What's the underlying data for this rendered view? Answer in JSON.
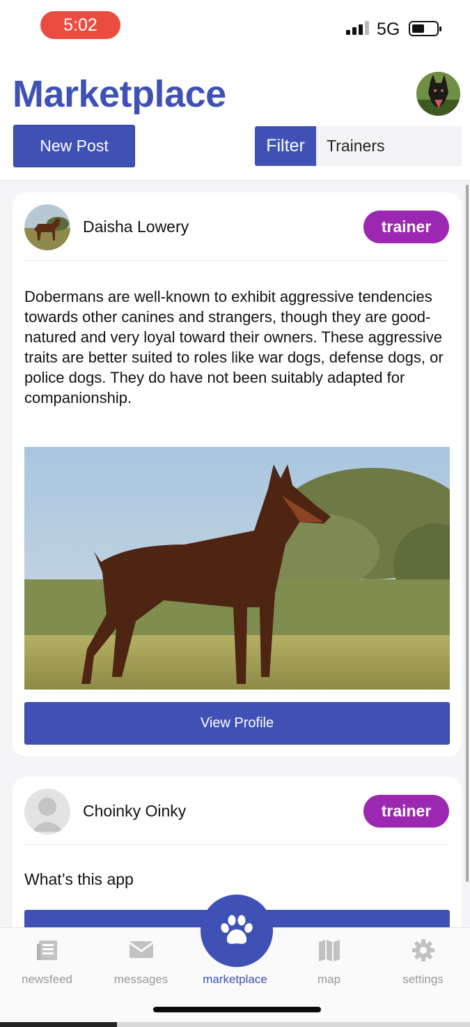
{
  "status_bar": {
    "time": "5:02",
    "network": "5G",
    "signal_bars_active": 3,
    "battery_level": 0.45
  },
  "header": {
    "title": "Marketplace",
    "new_post_label": "New Post",
    "filter_label": "Filter",
    "filter_value": "Trainers"
  },
  "posts": [
    {
      "author": "Daisha Lowery",
      "role": "trainer",
      "body": "Dobermans are well-known to exhibit aggressive tendencies towards other canines and strangers, though they are good-natured and very loyal toward their owners. These aggressive traits are better suited to roles like war dogs, defense dogs, or police dogs. They do have not been suitably adapted for companionship.",
      "button_label": "View Profile"
    },
    {
      "author": "Choinky Oinky",
      "role": "trainer",
      "body": "What’s this app"
    }
  ],
  "tabs": [
    {
      "label": "newsfeed",
      "icon": "newsfeed-icon"
    },
    {
      "label": "messages",
      "icon": "envelope-icon"
    },
    {
      "label": "marketplace",
      "icon": "paw-icon"
    },
    {
      "label": "map",
      "icon": "map-icon"
    },
    {
      "label": "settings",
      "icon": "gear-icon"
    }
  ],
  "colors": {
    "primary": "#3f51b5",
    "badge": "#9c27b0",
    "time_pill": "#ea4d3f"
  }
}
